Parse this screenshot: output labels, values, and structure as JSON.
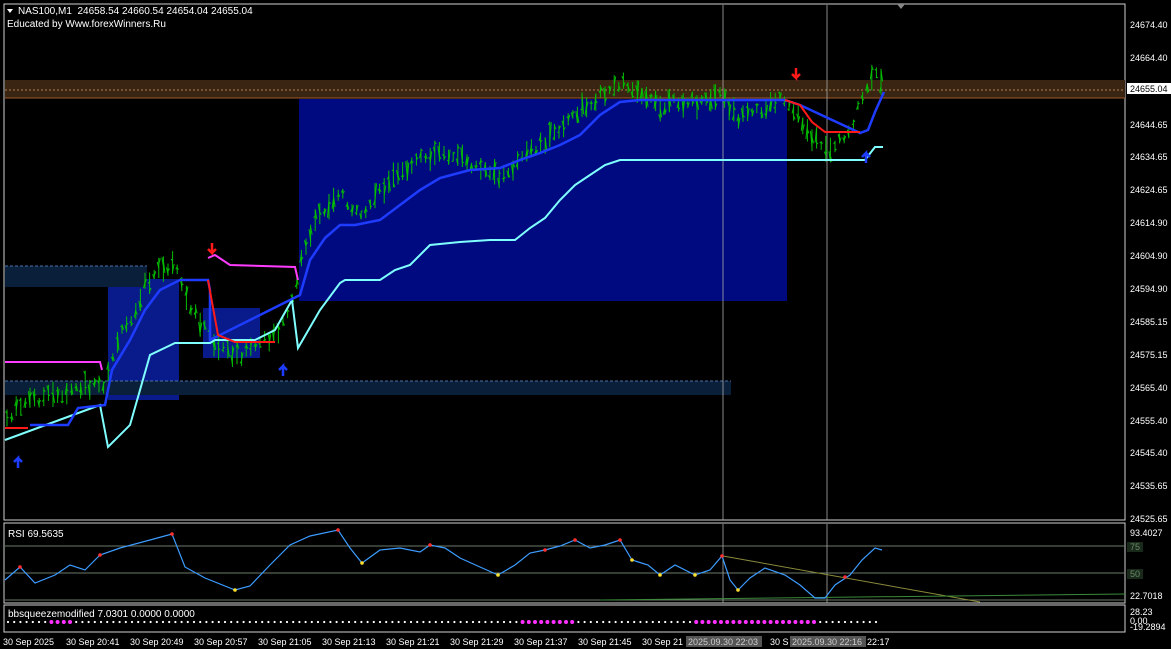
{
  "header": {
    "symbol": "NAS100,M1",
    "ohlc": "24658.54 24660.54 24654.04 24655.04",
    "educated": "Educated by Www.forexWinners.Ru"
  },
  "price_axis": {
    "labels": [
      "24674.40",
      "24664.40",
      "24644.65",
      "24634.65",
      "24624.65",
      "24614.90",
      "24604.90",
      "24594.90",
      "24585.15",
      "24575.15",
      "24565.40",
      "24555.40",
      "24545.40",
      "24535.65",
      "24525.65"
    ],
    "current_price": "24655.04"
  },
  "rsi": {
    "label": "RSI 69.5635",
    "axis": [
      "93.4027",
      "75",
      "50",
      "22.7018"
    ]
  },
  "bb": {
    "label": "bbsqueezemodified 7.0301 0.0000 0.0000",
    "axis": [
      "28.23",
      "0.00",
      "-19.2894"
    ]
  },
  "time_axis": {
    "labels": [
      "30 Sep 2025",
      "30 Sep 20:41",
      "30 Sep 20:49",
      "30 Sep 20:57",
      "30 Sep 21:05",
      "30 Sep 21:13",
      "30 Sep 21:21",
      "30 Sep 21:29",
      "30 Sep 21:37",
      "30 Sep 21:45",
      "30 Sep 21"
    ],
    "cursor1": "2025.09.30 22:03",
    "cursor2": "2025.09.30 22:16",
    "tail1": "30 S",
    "tail2": "22:17"
  },
  "colors": {
    "bull_bar": "#00c000",
    "bear_bar": "#ff0000",
    "trail_blue": "#1e3cff",
    "trail_red": "#ff1a1a",
    "trail_magenta": "#ff3cff",
    "trail_cyan": "#7fffff",
    "box_blue": "#000a80",
    "rsi_line": "#3c9cff"
  },
  "chart_data": {
    "type": "line",
    "title": "",
    "xlabel": "",
    "ylabel": "",
    "ylim": [
      24523,
      24680
    ]
  }
}
